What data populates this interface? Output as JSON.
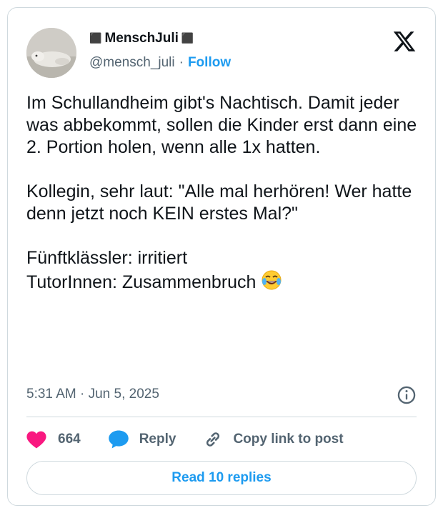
{
  "author": {
    "name": "MenschJuli",
    "deco_left": "⬛",
    "deco_right": "⬛",
    "handle": "@mensch_juli",
    "separator": "·",
    "follow_label": "Follow"
  },
  "tweet": {
    "text": "Im Schullandheim gibt's Nachtisch. Damit jeder was abbekommt, sollen die Kinder erst dann eine 2. Portion holen, wenn alle 1x hatten.\n\nKollegin, sehr laut: \"Alle mal herhören! Wer hatte denn jetzt noch KEIN erstes Mal?\"\n\nFünftklässler: irritiert\nTutorInnen: Zusammenbruch ",
    "timestamp": "5:31 AM · Jun 5, 2025"
  },
  "actions": {
    "likes_count": "664",
    "reply_label": "Reply",
    "copy_label": "Copy link to post"
  },
  "footer": {
    "read_replies_label": "Read 10 replies"
  },
  "colors": {
    "accent": "#1d9bf0",
    "heart": "#f91880",
    "text": "#0f1419",
    "muted": "#536471",
    "border": "#cfd9de"
  },
  "icons": [
    "x-logo-icon",
    "info-icon",
    "heart-icon",
    "reply-bubble-icon",
    "link-icon",
    "laughing-emoji-icon"
  ]
}
